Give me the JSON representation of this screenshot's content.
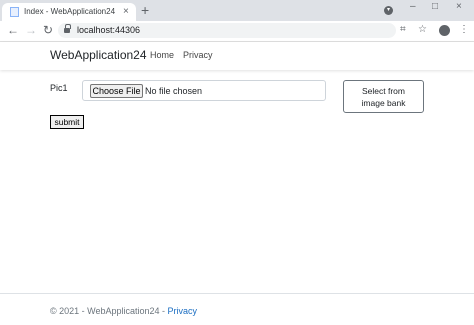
{
  "browser": {
    "tab_title": "Index - WebApplication24",
    "tab_close": "×",
    "new_tab": "+",
    "url": "localhost:44306",
    "window_controls": {
      "minimize": "–",
      "maximize": "□",
      "close": "×"
    },
    "icons": [
      "favicon-icon",
      "back-icon",
      "forward-icon",
      "reload-icon",
      "lock-icon",
      "qr-icon",
      "star-icon",
      "profile-icon",
      "menu-icon"
    ]
  },
  "navbar": {
    "brand": "WebApplication24",
    "links": [
      "Home",
      "Privacy"
    ]
  },
  "form": {
    "pic_label": "Pic1",
    "choose_file": "Choose File",
    "no_file": "No file chosen",
    "image_bank_line1": "Select from",
    "image_bank_line2": "image bank",
    "submit": "submit"
  },
  "footer": {
    "text": "© 2021 - WebApplication24 - ",
    "link": "Privacy"
  }
}
